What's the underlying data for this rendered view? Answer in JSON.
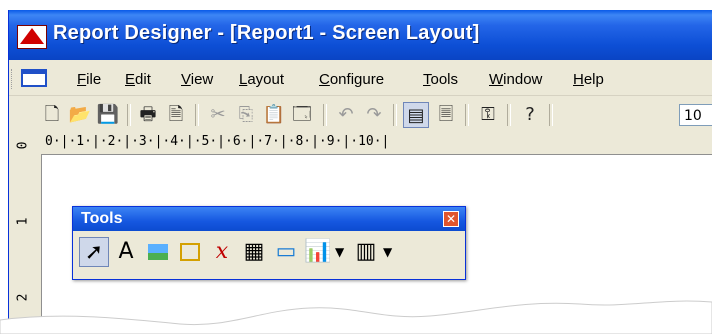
{
  "window": {
    "title": "Report Designer - [Report1 - Screen Layout]"
  },
  "menu": {
    "items": [
      "File",
      "Edit",
      "View",
      "Layout",
      "Configure",
      "Tools",
      "Window",
      "Help"
    ]
  },
  "toolbar": {
    "buttons": [
      "new-icon",
      "open-icon",
      "save-icon",
      "print-icon",
      "print-preview-icon",
      "cut-icon",
      "copy-icon",
      "paste-icon",
      "properties-icon",
      "undo-icon",
      "redo-icon",
      "page-layout-icon",
      "page-icon",
      "key-icon",
      "help-icon"
    ],
    "zoom_value": "10"
  },
  "ruler": {
    "horizontal_text": "0·|·1·|·2·|·3·|·4·|·5·|·6·|·7·|·8·|·9·|·10·|",
    "vertical_marks": [
      "0",
      "1",
      "2"
    ]
  },
  "tools_palette": {
    "title": "Tools",
    "tools": [
      "pointer-icon",
      "text-icon",
      "picture-icon",
      "rectangle-icon",
      "variable-icon",
      "calculator-icon",
      "field-icon",
      "chart-icon",
      "table-icon"
    ]
  },
  "colors": {
    "title_bar": "#0a44c4",
    "accent": "#0831d9"
  }
}
